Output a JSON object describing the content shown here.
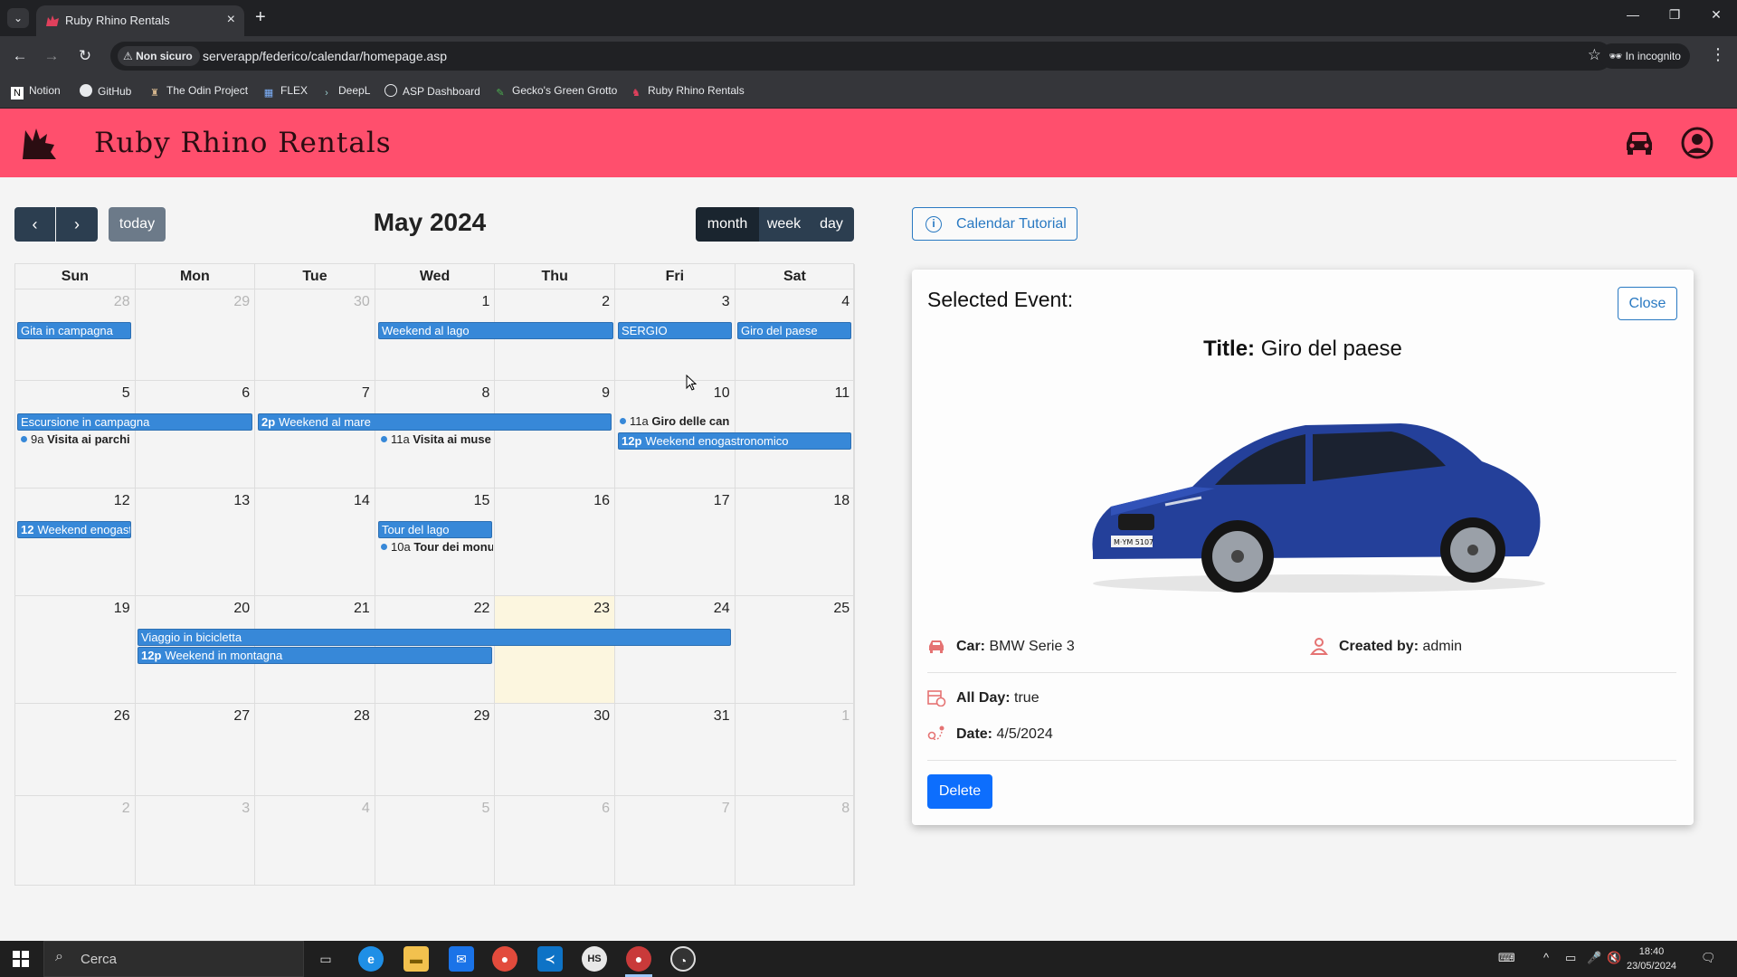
{
  "browser": {
    "tab_title": "Ruby Rhino Rentals",
    "security_label": "Non sicuro",
    "url": "serverapp/federico/calendar/homepage.asp",
    "incognito_label": "In incognito",
    "bookmarks": [
      {
        "label": "Notion",
        "icon": "notion-icon"
      },
      {
        "label": "GitHub",
        "icon": "github-icon"
      },
      {
        "label": "The Odin Project",
        "icon": "odin-icon"
      },
      {
        "label": "FLEX",
        "icon": "flex-icon"
      },
      {
        "label": "DeepL",
        "icon": "deepl-icon"
      },
      {
        "label": "ASP Dashboard",
        "icon": "asp-icon"
      },
      {
        "label": "Gecko's Green Grotto",
        "icon": "gecko-icon"
      },
      {
        "label": "Ruby Rhino Rentals",
        "icon": "rhino-icon"
      }
    ]
  },
  "app": {
    "brand": "Ruby Rhino Rentals",
    "header_color": "#ff4f6d"
  },
  "calendar": {
    "title": "May 2024",
    "today_label": "today",
    "views": [
      "month",
      "week",
      "day"
    ],
    "active_view": "month",
    "weekdays": [
      "Sun",
      "Mon",
      "Tue",
      "Wed",
      "Thu",
      "Fri",
      "Sat"
    ],
    "weeks": [
      [
        "28",
        "29",
        "30",
        "1",
        "2",
        "3",
        "4"
      ],
      [
        "5",
        "6",
        "7",
        "8",
        "9",
        "10",
        "11"
      ],
      [
        "12",
        "13",
        "14",
        "15",
        "16",
        "17",
        "18"
      ],
      [
        "19",
        "20",
        "21",
        "22",
        "23",
        "24",
        "25"
      ],
      [
        "26",
        "27",
        "28",
        "29",
        "30",
        "31",
        "1"
      ],
      [
        "2",
        "3",
        "4",
        "5",
        "6",
        "7",
        "8"
      ]
    ],
    "events": {
      "gita": "Gita in campagna",
      "weekend_lago": "Weekend al lago",
      "sergio": "SERGIO",
      "giro_paese": "Giro del paese",
      "escursione": "Escursione in campagna",
      "visita_parchi_time": "9a",
      "visita_parchi": "Visita ai parchi",
      "weekend_mare_time": "2p",
      "weekend_mare": "Weekend al mare",
      "visita_musei_time": "11a",
      "visita_musei": "Visita ai muse",
      "giro_cantine_time": "11a",
      "giro_cantine": "Giro delle can",
      "enogastro_time": "12p",
      "enogastro": "Weekend enogastronomico",
      "enogastro2_time": "12",
      "enogastro2": "Weekend enogast",
      "tour_lago": "Tour del lago",
      "tour_monumenti_time": "10a",
      "tour_monumenti": "Tour dei monu",
      "viaggio_bici": "Viaggio in bicicletta",
      "montagna_time": "12p",
      "montagna": "Weekend in montagna"
    },
    "event_color": "#3788d8",
    "today_color": "#fcf6df"
  },
  "tutorial_label": "Calendar Tutorial",
  "selected_event": {
    "heading": "Selected Event:",
    "close_label": "Close",
    "title_label": "Title:",
    "title_value": "Giro del paese",
    "car_label": "Car:",
    "car_value": "BMW Serie 3",
    "created_label": "Created by:",
    "created_value": "admin",
    "allday_label": "All Day:",
    "allday_value": "true",
    "date_label": "Date:",
    "date_value": "4/5/2024",
    "delete_label": "Delete",
    "plate": "M·YM 5107"
  },
  "taskbar": {
    "search_placeholder": "Cerca",
    "time": "18:40",
    "date": "23/05/2024"
  }
}
